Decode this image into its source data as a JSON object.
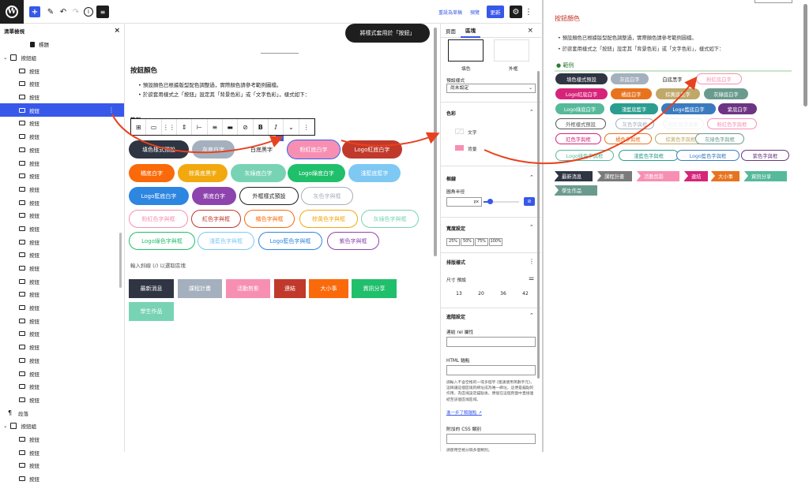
{
  "topbar": {
    "wp_logo": "W",
    "add_icon": "+",
    "pen_icon": "✎",
    "undo_icon": "↶",
    "redo_icon": "↷",
    "info_icon": "i",
    "list_icon": "≡",
    "switch_draft": "重設為草稿",
    "preview": "預覽",
    "update": "更新",
    "settings_icon": "⚙",
    "more_icon": "⋮"
  },
  "listview": {
    "title": "清單檢視",
    "close": "×",
    "rows": [
      {
        "label": "標題",
        "indent": 2,
        "icon": "bookmark"
      },
      {
        "label": "按鈕組",
        "indent": 0,
        "icon": "group",
        "caret": "⌄"
      },
      {
        "label": "按鈕",
        "indent": 1
      },
      {
        "label": "按鈕",
        "indent": 1
      },
      {
        "label": "按鈕",
        "indent": 1
      },
      {
        "label": "按鈕",
        "indent": 1,
        "selected": true
      },
      {
        "label": "按鈕",
        "indent": 1
      },
      {
        "label": "按鈕",
        "indent": 1
      },
      {
        "label": "按鈕",
        "indent": 1
      },
      {
        "label": "按鈕",
        "indent": 1
      },
      {
        "label": "按鈕",
        "indent": 1
      },
      {
        "label": "按鈕",
        "indent": 1
      },
      {
        "label": "按鈕",
        "indent": 1
      },
      {
        "label": "按鈕",
        "indent": 1
      },
      {
        "label": "按鈕",
        "indent": 1
      },
      {
        "label": "按鈕",
        "indent": 1
      },
      {
        "label": "按鈕",
        "indent": 1
      },
      {
        "label": "按鈕",
        "indent": 1
      },
      {
        "label": "按鈕",
        "indent": 1
      },
      {
        "label": "按鈕",
        "indent": 1
      },
      {
        "label": "按鈕",
        "indent": 1
      },
      {
        "label": "按鈕",
        "indent": 1
      },
      {
        "label": "按鈕",
        "indent": 1
      },
      {
        "label": "按鈕",
        "indent": 1
      },
      {
        "label": "按鈕",
        "indent": 1
      },
      {
        "label": "按鈕",
        "indent": 1
      },
      {
        "label": "按鈕",
        "indent": 1
      },
      {
        "label": "按鈕",
        "indent": 1
      },
      {
        "label": "段落",
        "indent": 0,
        "icon": "para"
      },
      {
        "label": "按鈕組",
        "indent": 0,
        "icon": "group",
        "caret": "⌄"
      },
      {
        "label": "按鈕",
        "indent": 1
      },
      {
        "label": "按鈕",
        "indent": 1
      },
      {
        "label": "按鈕",
        "indent": 1
      },
      {
        "label": "按鈕",
        "indent": 1
      }
    ]
  },
  "canvas": {
    "toast": "將樣式套用於「按鈕」",
    "heading": "按鈕顏色",
    "bullets": [
      "預設顏色已根據版型配色調整過，實際顏色請參考範例圖檔。",
      "於欲套用樣式之「按鈕」設定其「背景色彩」或「文字色彩」，樣式如下："
    ],
    "example_label": "範例",
    "hint": "輸入斜線 (/) 以選取區塊",
    "toolbar_items": [
      "⊞",
      "▭",
      "⋮⋮",
      "⇕",
      "⊢",
      "≡",
      "▬",
      "⊘",
      "B",
      "I",
      "⌄",
      "⋮"
    ],
    "pills": [
      {
        "text": "填色樣式預設",
        "bg": "#2f3542",
        "fg": "#ffffff"
      },
      {
        "text": "灰底白字",
        "bg": "#a4b0be",
        "fg": "#ffffff"
      },
      {
        "text": "白底黑字",
        "bg": "#ffffff",
        "fg": "#1e1e1e"
      },
      {
        "text": "粉紅底白字",
        "bg": "#f78fb3",
        "fg": "#ffffff",
        "selected": true
      },
      {
        "text": "Logo紅底白字",
        "bg": "#c0392b",
        "fg": "#ffffff"
      },
      {
        "text": "橘底白字",
        "bg": "#fa6a0a",
        "fg": "#ffffff"
      },
      {
        "text": "棕黃底黑字",
        "bg": "#f1a90f",
        "fg": "#ffffff"
      },
      {
        "text": "灰綠底白字",
        "bg": "#78d3b5",
        "fg": "#ffffff"
      },
      {
        "text": "Logo綠底白字",
        "bg": "#20bf6b",
        "fg": "#ffffff"
      },
      {
        "text": "淺藍底藍字",
        "bg": "#7ec8f4",
        "fg": "#ffffff"
      },
      {
        "text": "Logo藍底白字",
        "bg": "#2d86e0",
        "fg": "#ffffff"
      },
      {
        "text": "紫底白字",
        "bg": "#8e44ad",
        "fg": "#ffffff"
      },
      {
        "text": "外框樣式預設",
        "bg": "#ffffff",
        "fg": "#1e1e1e",
        "border": "#1e1e1e"
      },
      {
        "text": "灰色字與框",
        "bg": "#ffffff",
        "fg": "#a4b0be",
        "border": "#a4b0be"
      },
      {
        "text": "粉紅色字與框",
        "bg": "#ffffff",
        "fg": "#f78fb3",
        "border": "#f78fb3"
      },
      {
        "text": "紅色字與框",
        "bg": "#ffffff",
        "fg": "#c0392b",
        "border": "#c0392b"
      },
      {
        "text": "橘色字與框",
        "bg": "#ffffff",
        "fg": "#fa6a0a",
        "border": "#fa6a0a"
      },
      {
        "text": "棕黃色字與框",
        "bg": "#ffffff",
        "fg": "#f1a90f",
        "border": "#f1a90f"
      },
      {
        "text": "灰綠色字與框",
        "bg": "#ffffff",
        "fg": "#78d3b5",
        "border": "#78d3b5"
      },
      {
        "text": "Logo綠色字與框",
        "bg": "#ffffff",
        "fg": "#20bf6b",
        "border": "#20bf6b"
      },
      {
        "text": "淺藍色字與框",
        "bg": "#ffffff",
        "fg": "#7ec8f4",
        "border": "#7ec8f4"
      },
      {
        "text": "Logo藍色字與框",
        "bg": "#ffffff",
        "fg": "#2d86e0",
        "border": "#2d86e0"
      },
      {
        "text": "紫色字與框",
        "bg": "#ffffff",
        "fg": "#8e44ad",
        "border": "#8e44ad"
      }
    ],
    "rects": [
      {
        "text": "最新消息",
        "bg": "#2f3542"
      },
      {
        "text": "課程計畫",
        "bg": "#a4b0be"
      },
      {
        "text": "活動剪影",
        "bg": "#f78fb3"
      },
      {
        "text": "連結",
        "bg": "#c0392b"
      },
      {
        "text": "大小事",
        "bg": "#fa6a0a"
      },
      {
        "text": "資訊分享",
        "bg": "#20bf6b"
      },
      {
        "text": "學生作品",
        "bg": "#78d3b5"
      }
    ]
  },
  "inspector": {
    "tab_page": "頁面",
    "tab_block": "區塊",
    "close": "×",
    "style_fill": "填色",
    "style_outline": "外框",
    "default_style_label": "預設樣式",
    "default_style_value": "尚未設定",
    "color_title": "色彩",
    "color_text": "文字",
    "color_bg": "背景",
    "border_title": "框線",
    "radius_label": "圓角半徑",
    "radius_unit": "px",
    "width_title": "寬度設定",
    "widths": [
      "25%",
      "50%",
      "75%",
      "100%"
    ],
    "typo_title": "排版樣式",
    "size_label": "尺寸 預設",
    "sizes": [
      "13",
      "20",
      "36",
      "42"
    ],
    "advanced_title": "進階設定",
    "rel_label": "連結 rel 屬性",
    "anchor_label": "HTML 錨點",
    "anchor_help": "請輸入不含空格的一或多個字 (建議使用英數字元)，這稱讓這個區塊的網址成為唯一網址，這便是錨點的作用，為區塊設定錨點後，便能在這個頁面中直接連結至該個區塊區域。",
    "learn_more": "進一步了解錨點",
    "css_label": "附加的 CSS 類別",
    "css_help": "請使用空格分隔多個類別。",
    "toggle_icon": "⌃",
    "more_icon": "⋮",
    "sliders_icon": "⚌",
    "link_icon": "⊘"
  },
  "preview": {
    "title": "按鈕顏色",
    "bullets": [
      "預設顏色已根據版型配色調整過，實際顏色請參考範例圖檔。",
      "於欲套用樣式之「按鈕」設定其「背景色彩」或「文字色彩」，樣式如下："
    ],
    "example_label": "範例",
    "pills": [
      {
        "text": "填色樣式預設",
        "bg": "#2f3542",
        "fg": "#ffffff"
      },
      {
        "text": "灰底白字",
        "bg": "#a4b0be",
        "fg": "#ffffff"
      },
      {
        "text": "白底黑字",
        "bg": "#ffffff",
        "fg": "#1e1e1e",
        "noborder": true
      },
      {
        "text": "粉紅底白字",
        "bg": "#ffffff",
        "fg": "#f78fb3",
        "border": "#f78fb3"
      },
      {
        "text": "Logo紅底白字",
        "bg": "#d6247a",
        "fg": "#ffffff"
      },
      {
        "text": "橘底白字",
        "bg": "#e8731e",
        "fg": "#ffffff"
      },
      {
        "text": "棕黃底黑字",
        "bg": "#bfa86a",
        "fg": "#ffffff"
      },
      {
        "text": "灰綠底白字",
        "bg": "#6a9a8e",
        "fg": "#ffffff"
      },
      {
        "text": "Logo綠底白字",
        "bg": "#55b99a",
        "fg": "#ffffff"
      },
      {
        "text": "淺藍底藍字",
        "bg": "#2a9d8f",
        "fg": "#ffffff"
      },
      {
        "text": "Logo藍底白字",
        "bg": "#3a7bbf",
        "fg": "#ffffff"
      },
      {
        "text": "紫底白字",
        "bg": "#6c3483",
        "fg": "#ffffff"
      },
      {
        "text": "外框樣式預設",
        "bg": "#ffffff",
        "fg": "#555555",
        "border": "#555555"
      },
      {
        "text": "灰色字與框",
        "bg": "#ffffff",
        "fg": "#a4b0be",
        "border": "#a4b0be"
      },
      {
        "text": "粉紅色字與框",
        "bg": "#ffffff",
        "fg": "#f0f0f0",
        "border": "#f4f4f4"
      },
      {
        "text": "粉紅色字與框",
        "bg": "#ffffff",
        "fg": "#f78fb3",
        "border": "#f78fb3"
      },
      {
        "text": "紅色字與框",
        "bg": "#ffffff",
        "fg": "#d6247a",
        "border": "#d6247a"
      },
      {
        "text": "橘色字與框",
        "bg": "#ffffff",
        "fg": "#e8731e",
        "border": "#e8731e"
      },
      {
        "text": "棕黃色字與框",
        "bg": "#ffffff",
        "fg": "#bfa86a",
        "border": "#bfa86a"
      },
      {
        "text": "灰綠色字與框",
        "bg": "#ffffff",
        "fg": "#6a9a8e",
        "border": "#6a9a8e"
      },
      {
        "text": "Logo綠色字與框",
        "bg": "#ffffff",
        "fg": "#55b99a",
        "border": "#55b99a"
      },
      {
        "text": "淺藍色字與框",
        "bg": "#ffffff",
        "fg": "#2a9d8f",
        "border": "#2a9d8f"
      },
      {
        "text": "Logo藍色字與框",
        "bg": "#ffffff",
        "fg": "#3a7bbf",
        "border": "#3a7bbf"
      },
      {
        "text": "紫色字與框",
        "bg": "#ffffff",
        "fg": "#6c3483",
        "border": "#6c3483"
      }
    ],
    "tags": [
      {
        "text": "最新消息",
        "bg": "#2f3542"
      },
      {
        "text": "課程計畫",
        "bg": "#7a7a7a"
      },
      {
        "text": "活動剪影",
        "bg": "#f78fb3"
      },
      {
        "text": "連結",
        "bg": "#d6247a"
      },
      {
        "text": "大小事",
        "bg": "#e8731e"
      },
      {
        "text": "資訊分享",
        "bg": "#55b99a"
      },
      {
        "text": "學生作品",
        "bg": "#6a9a8e"
      }
    ]
  },
  "colors": {
    "accent": "#3858e9",
    "annotation_arrow": "#e8411f"
  }
}
